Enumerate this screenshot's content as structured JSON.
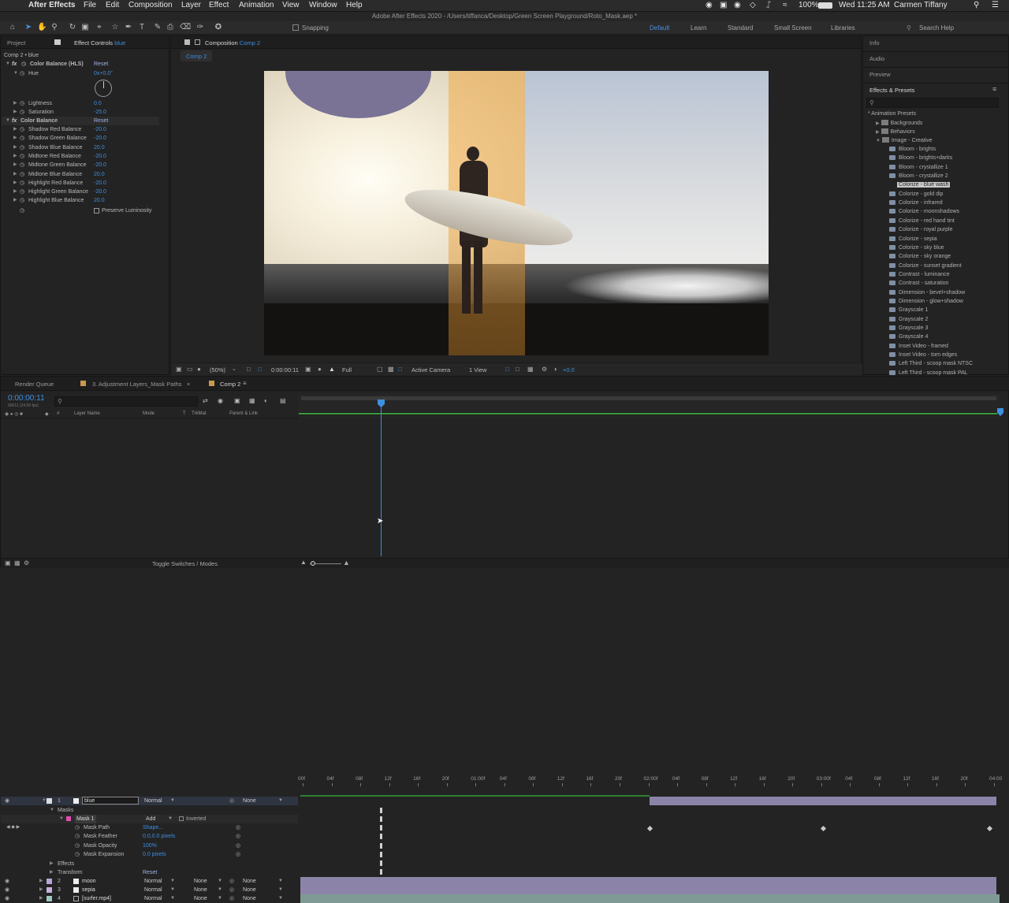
{
  "menubar": {
    "apple": "",
    "app": "After Effects",
    "items": [
      "File",
      "Edit",
      "Composition",
      "Layer",
      "Effect",
      "Animation",
      "View",
      "Window",
      "Help"
    ],
    "battery": "100%",
    "clock": "Wed 11:25 AM",
    "user": "Carmen Tiffany"
  },
  "title": "Adobe After Effects 2020 - /Users/tiffanca/Desktop/Green Screen Playground/Roto_Mask.aep *",
  "toolbar": {
    "snapping": "Snapping",
    "workspaces": [
      "Default",
      "Learn",
      "Standard",
      "Small Screen",
      "Libraries"
    ],
    "search_help": "Search Help"
  },
  "effect_controls": {
    "tab_project": "Project",
    "tab_effect": "Effect Controls",
    "tab_effect_layer": "blue",
    "subtitle": "Comp 2 • blue",
    "hls": {
      "name": "Color Balance (HLS)",
      "reset": "Reset",
      "hue_label": "Hue",
      "hue_value": "0x+0.0°",
      "lightness_label": "Lightness",
      "lightness_value": "0.0",
      "saturation_label": "Saturation",
      "saturation_value": "-25.0"
    },
    "cb": {
      "name": "Color Balance",
      "reset": "Reset",
      "params": [
        {
          "label": "Shadow Red Balance",
          "value": "-20.0"
        },
        {
          "label": "Shadow Green Balance",
          "value": "-20.0"
        },
        {
          "label": "Shadow Blue Balance",
          "value": "20.0"
        },
        {
          "label": "Midtone Red Balance",
          "value": "-20.0"
        },
        {
          "label": "Midtone Green Balance",
          "value": "-20.0"
        },
        {
          "label": "Midtone Blue Balance",
          "value": "20.0"
        },
        {
          "label": "Highlight Red Balance",
          "value": "-20.0"
        },
        {
          "label": "Highlight Green Balance",
          "value": "-20.0"
        },
        {
          "label": "Highlight Blue Balance",
          "value": "20.0"
        }
      ],
      "preserve": "Preserve Luminosity"
    }
  },
  "composition": {
    "tab_prefix": "Composition",
    "tab_name": "Comp 2",
    "breadcrumb": "Comp 2",
    "zoom": "(50%)",
    "time": "0:00:00:11",
    "resolution": "Full",
    "camera": "Active Camera",
    "view": "1 View",
    "exposure": "+0.0"
  },
  "right_panels": {
    "info": "Info",
    "audio": "Audio",
    "preview": "Preview",
    "effects_presets": "Effects & Presets",
    "tree": {
      "root": "* Animation Presets",
      "folders": [
        "Backgrounds",
        "Behaviors",
        "Image - Creative"
      ],
      "presets": [
        "Bloom - brights",
        "Bloom - brights+darks",
        "Bloom - crystallize 1",
        "Bloom - crystallize 2",
        "Colorize - blue wash",
        "Colorize - gold dip",
        "Colorize - infrared",
        "Colorize - moonshadows",
        "Colorize - red hand tint",
        "Colorize - royal purple",
        "Colorize - sepia",
        "Colorize - sky blue",
        "Colorize - sky orange",
        "Colorize - sunset gradient",
        "Contrast - luminance",
        "Contrast - saturation",
        "Dimension - bevel+shadow",
        "Dimension - glow+shadow",
        "Grayscale 1",
        "Grayscale 2",
        "Grayscale 3",
        "Grayscale 4",
        "Inset Video - framed",
        "Inset Video - torn edges",
        "Left Third - scoop mask NTSC",
        "Left Third - scoop mask PAL"
      ],
      "selected": "Colorize - blue wash"
    }
  },
  "timeline": {
    "tabs": [
      "Render Queue",
      "3. Adjustment Layers_Mask Paths",
      "Comp 2"
    ],
    "timecode": "0:00:00:11",
    "timecode_sub": "00011 (24.00 fps)",
    "headers": {
      "layer_name": "Layer Name",
      "mode": "Mode",
      "t": "T",
      "trkmat": "TrkMat",
      "parent": "Parent & Link"
    },
    "ruler": [
      "00f",
      "04f",
      "08f",
      "12f",
      "16f",
      "20f",
      "01:00f",
      "04f",
      "08f",
      "12f",
      "16f",
      "20f",
      "02:00f",
      "04f",
      "08f",
      "12f",
      "16f",
      "20f",
      "03:00f",
      "04f",
      "08f",
      "12f",
      "16f",
      "20f",
      "04:00"
    ],
    "layers": [
      {
        "num": "1",
        "name": "blue",
        "mode": "Normal",
        "trkmat": "",
        "parent": "None"
      },
      {
        "num": "2",
        "name": "moon",
        "mode": "Normal",
        "trkmat": "None",
        "parent": "None"
      },
      {
        "num": "3",
        "name": "sepia",
        "mode": "Normal",
        "trkmat": "None",
        "parent": "None"
      },
      {
        "num": "4",
        "name": "[surfer.mp4]",
        "mode": "Normal",
        "trkmat": "None",
        "parent": "None"
      }
    ],
    "masks": {
      "label": "Masks",
      "mask_name": "Mask 1",
      "mask_mode": "Add",
      "inverted": "Inverted",
      "props": [
        {
          "label": "Mask Path",
          "value": "Shape..."
        },
        {
          "label": "Mask Feather",
          "value": "0.0,0.0 pixels"
        },
        {
          "label": "Mask Opacity",
          "value": "100%"
        },
        {
          "label": "Mask Expansion",
          "value": "0.0 pixels"
        }
      ]
    },
    "effects": "Effects",
    "transform": "Transform",
    "transform_reset": "Reset",
    "toggle": "Toggle Switches / Modes"
  }
}
